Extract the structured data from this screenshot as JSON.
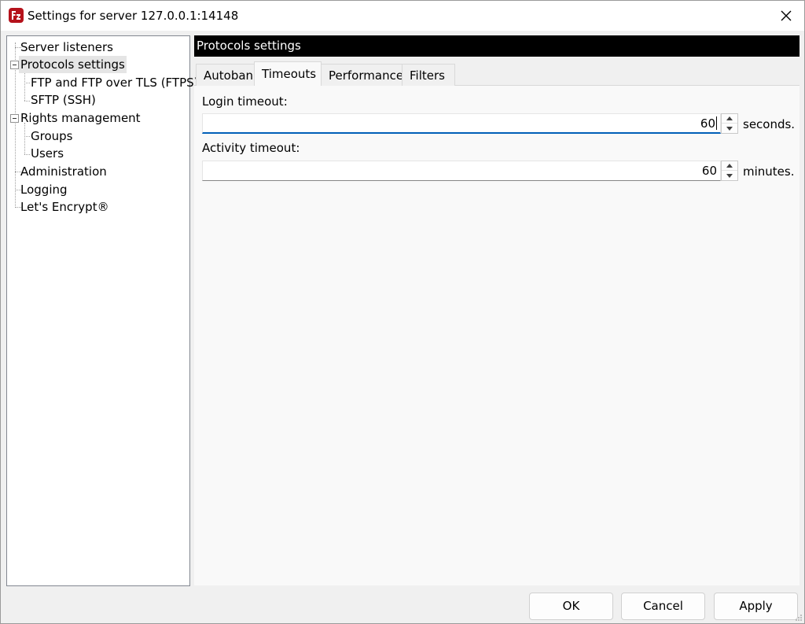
{
  "window": {
    "title": "Settings for server 127.0.0.1:14148"
  },
  "tree": {
    "items": [
      {
        "label": "Server listeners"
      },
      {
        "label": "Protocols settings"
      },
      {
        "label": "FTP and FTP over TLS (FTPS)"
      },
      {
        "label": "SFTP (SSH)"
      },
      {
        "label": "Rights management"
      },
      {
        "label": "Groups"
      },
      {
        "label": "Users"
      },
      {
        "label": "Administration"
      },
      {
        "label": "Logging"
      },
      {
        "label": "Let's Encrypt®"
      }
    ],
    "selected": "Protocols settings"
  },
  "panel": {
    "header": "Protocols settings",
    "tabs": [
      {
        "label": "Autoban"
      },
      {
        "label": "Timeouts"
      },
      {
        "label": "Performance"
      },
      {
        "label": "Filters"
      }
    ],
    "active_tab": "Timeouts",
    "login_timeout": {
      "label": "Login timeout:",
      "value": "60",
      "unit": "seconds."
    },
    "activity_timeout": {
      "label": "Activity timeout:",
      "value": "60",
      "unit": "minutes."
    }
  },
  "buttons": {
    "ok": "OK",
    "cancel": "Cancel",
    "apply": "Apply"
  },
  "colors": {
    "focus_accent": "#005fb8",
    "header_bg": "#000000",
    "app_icon_red": "#b5121b"
  },
  "icons": {
    "app": "filezilla-server-icon",
    "close": "close-icon",
    "spin_up": "arrow-up-icon",
    "spin_down": "arrow-down-icon",
    "collapse": "minus-expander-icon",
    "grip": "resize-grip-icon"
  }
}
